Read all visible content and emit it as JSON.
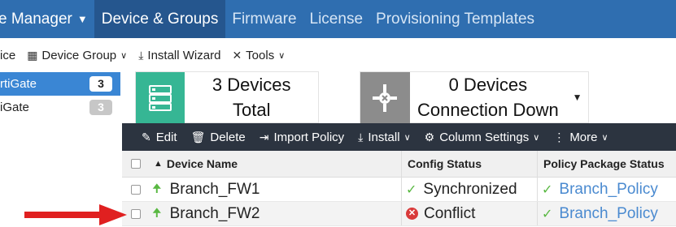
{
  "topnav": {
    "app_title": "e Manager",
    "items": [
      {
        "label": "Device & Groups",
        "active": true
      },
      {
        "label": "Firmware"
      },
      {
        "label": "License"
      },
      {
        "label": "Provisioning Templates"
      }
    ]
  },
  "toolbar": {
    "partial_label": "ice",
    "device_group": "Device Group",
    "install_wizard": "Install Wizard",
    "tools": "Tools"
  },
  "tree": {
    "items": [
      {
        "label": "rtiGate",
        "count": "3",
        "selected": true
      },
      {
        "label": "iGate",
        "count": "3",
        "selected": false
      }
    ]
  },
  "cards": {
    "devices_total": {
      "count_line": "3 Devices",
      "label": "Total",
      "color": "#36b694"
    },
    "connection_down": {
      "count_line": "0 Devices",
      "label": "Connection Down",
      "color": "#8c8c8c"
    }
  },
  "gridbar": {
    "edit": "Edit",
    "delete": "Delete",
    "import_policy": "Import Policy",
    "install": "Install",
    "column_settings": "Column Settings",
    "more": "More"
  },
  "table": {
    "headers": {
      "device_name": "Device Name",
      "config_status": "Config Status",
      "policy_package_status": "Policy Package Status"
    },
    "rows": [
      {
        "device": "Branch_FW1",
        "config_status": "Synchronized",
        "policy": "Branch_Policy"
      },
      {
        "device": "Branch_FW2",
        "config_status": "Conflict",
        "policy": "Branch_Policy"
      }
    ]
  },
  "colors": {
    "nav_bg": "#2f6eb0",
    "nav_active": "#25568e",
    "grid_bar": "#2c3440",
    "ok_green": "#59b842",
    "error_red": "#d93a3a",
    "link_blue": "#4a8ad0",
    "annotation_red": "#e02020"
  }
}
